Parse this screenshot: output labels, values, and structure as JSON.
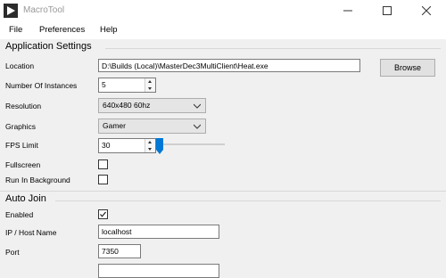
{
  "window": {
    "title": "MacroTool"
  },
  "icons": {
    "app": "macrotool-icon",
    "minimize": "minimize-icon",
    "maximize": "maximize-icon",
    "close": "close-icon"
  },
  "menu": [
    {
      "label": "File"
    },
    {
      "label": "Preferences"
    },
    {
      "label": "Help"
    }
  ],
  "app_settings": {
    "title": "Application Settings",
    "location": {
      "label": "Location",
      "value": "D:\\Builds (Local)\\MasterDec3MultiClient\\Heat.exe"
    },
    "browse_label": "Browse",
    "instances": {
      "label": "Number Of Instances",
      "value": "5"
    },
    "resolution": {
      "label": "Resolution",
      "value": "640x480 60hz"
    },
    "graphics": {
      "label": "Graphics",
      "value": "Gamer"
    },
    "fps": {
      "label": "FPS Limit",
      "value": "30"
    },
    "fullscreen": {
      "label": "Fullscreen",
      "checked": false
    },
    "background": {
      "label": "Run In Background",
      "checked": false
    }
  },
  "auto_join": {
    "title": "Auto Join",
    "enabled": {
      "label": "Enabled",
      "checked": true
    },
    "host": {
      "label": "IP / Host Name",
      "value": "localhost"
    },
    "port": {
      "label": "Port",
      "value": "7350"
    }
  }
}
